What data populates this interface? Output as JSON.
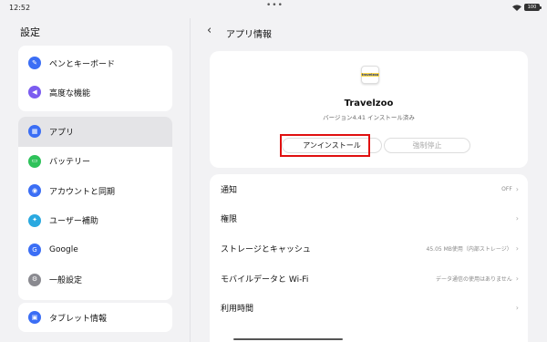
{
  "status_bar": {
    "time": "12:52",
    "battery": "100"
  },
  "settings": {
    "title": "設定",
    "group1": [
      {
        "label": "ペンとキーボード",
        "icon_glyph": "✎",
        "color": "#3b6ef5"
      },
      {
        "label": "高度な機能",
        "icon_glyph": "◀",
        "color": "#7b5cf0"
      }
    ],
    "group2": [
      {
        "label": "アプリ",
        "icon_glyph": "▦",
        "color": "#3b6ef5"
      },
      {
        "label": "バッテリー",
        "icon_glyph": "▭",
        "color": "#2ec25a"
      },
      {
        "label": "アカウントと同期",
        "icon_glyph": "◉",
        "color": "#3b6ef5"
      },
      {
        "label": "ユーザー補助",
        "icon_glyph": "✦",
        "color": "#2aa9e0"
      },
      {
        "label": "Google",
        "icon_glyph": "G",
        "color": "#3b6ef5"
      },
      {
        "label": "一般設定",
        "icon_glyph": "⚙",
        "color": "#8a8a90"
      }
    ],
    "group3": [
      {
        "label": "タブレット情報",
        "icon_glyph": "▣",
        "color": "#3b6ef5"
      }
    ]
  },
  "app_info": {
    "back_glyph": "‹",
    "title": "アプリ情報",
    "icon_text": "travelzoo",
    "app_name": "Travelzoo",
    "version": "バージョン4.41 インストール済み",
    "uninstall_label": "アンインストール",
    "force_stop_label": "強制停止",
    "rows": [
      {
        "label": "通知",
        "value": "OFF"
      },
      {
        "label": "権限",
        "value": ""
      },
      {
        "label": "ストレージとキャッシュ",
        "value": "45.05 MB使用（内部ストレージ）"
      },
      {
        "label": "モバイルデータと Wi-Fi",
        "value": "データ通信の使用はありません"
      },
      {
        "label": "利用時間",
        "value": ""
      }
    ],
    "chevron": "›"
  }
}
